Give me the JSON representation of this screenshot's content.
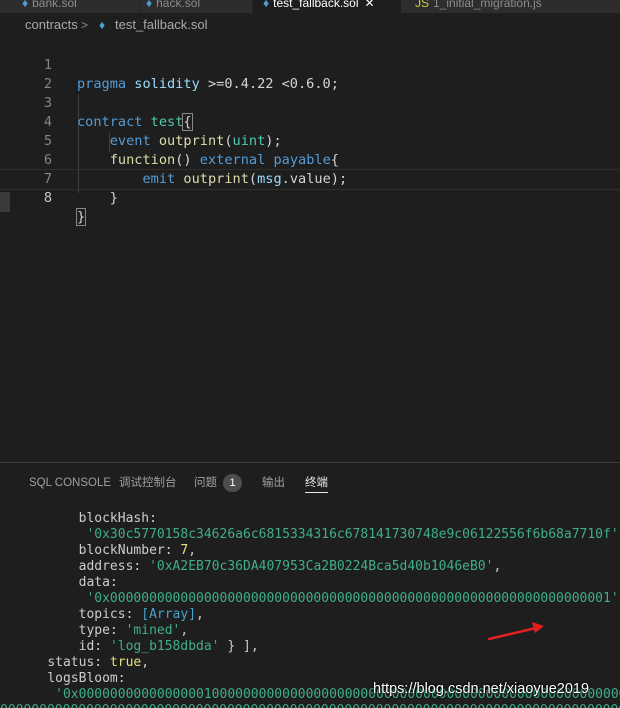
{
  "tabs": [
    {
      "label": "bank.sol",
      "icon": "solidity-file-icon",
      "active": false
    },
    {
      "label": "hack.sol",
      "icon": "solidity-file-icon",
      "active": false
    },
    {
      "label": "test_fallback.sol",
      "icon": "solidity-file-icon",
      "active": true
    },
    {
      "label": "1_initial_migration.js",
      "icon": "javascript-file-icon",
      "active": false
    }
  ],
  "breadcrumb": {
    "folder": "contracts",
    "separator": ">",
    "file_icon": "solidity-file-icon",
    "file": "test_fallback.sol"
  },
  "editor": {
    "line_numbers": [
      "1",
      "2",
      "3",
      "4",
      "5",
      "6",
      "7",
      "8"
    ],
    "code": {
      "l1": {
        "kw": "pragma",
        "name": "solidity",
        "rest": " >=0.4.22 <0.6.0;"
      },
      "l3": {
        "kw": "contract",
        "name": "test",
        "brace": "{"
      },
      "l4": {
        "indent": "    ",
        "kw": "event",
        "fn": "outprint",
        "open": "(",
        "type": "uint",
        "close": ");"
      },
      "l5": {
        "indent": "    ",
        "kw": "function",
        "open": "() ",
        "mod1": "external",
        "space": " ",
        "mod2": "payable",
        "brace": "{"
      },
      "l6": {
        "indent": "        ",
        "kw": "emit",
        "fn": "outprint",
        "open": "(",
        "obj": "msg",
        "rest": ".value);"
      },
      "l7": {
        "indent": "    ",
        "text": "}"
      },
      "l8": {
        "text": "}"
      }
    }
  },
  "panel": {
    "tabs": {
      "sql_console": "SQL CONSOLE",
      "debug_console": "调试控制台",
      "problems": "问题",
      "problems_count": "1",
      "output": "输出",
      "terminal": "终端"
    },
    "terminal": {
      "l01": {
        "indent": "        ",
        "key": "blockHash:"
      },
      "l02": {
        "indent": "         ",
        "str": "'0x30c5770158c34626a6c6815334316c678141730748e9c06122556f6b68a7710f'",
        "tail": ","
      },
      "l03": {
        "indent": "        ",
        "key": "blockNumber: ",
        "num": "7",
        "tail": ","
      },
      "l04": {
        "indent": "        ",
        "key": "address: ",
        "str": "'0xA2EB70c36DA407953Ca2B0224Bca5d40b1046eB0'",
        "tail": ","
      },
      "l05": {
        "indent": "        ",
        "key": "data:"
      },
      "l06": {
        "indent": "         ",
        "str": "'0x0000000000000000000000000000000000000000000000000000000000000001'",
        "tail": ","
      },
      "l07": {
        "indent": "        ",
        "key": "topics: ",
        "ref": "[Array]",
        "tail": ","
      },
      "l08": {
        "indent": "        ",
        "key": "type: ",
        "str": "'mined'",
        "tail": ","
      },
      "l09": {
        "indent": "        ",
        "key": "id: ",
        "str": "'log_b158dbda'",
        "tail": " } ],"
      },
      "l10": {
        "indent": "    ",
        "key": "status: ",
        "num": "true",
        "tail": ","
      },
      "l11": {
        "indent": "    ",
        "key": "logsBloom:"
      },
      "l12": {
        "indent": "     ",
        "str": "'0x0000000000000000100000000000000000000000000000000000000000000000000000000"
      },
      "l13": {
        "str": "00000000000000000000000000000000000000000000000000000000000000000000000000000000000000"
      }
    }
  },
  "watermark": "https://blog.csdn.net/xiaoyue2019",
  "colors": {
    "background": "#1e1e1e",
    "keyword": "#569cd6",
    "function": "#dcdcaa",
    "type": "#4ec9b0",
    "variable": "#9cdcfe",
    "terminal_string": "#3fae8a",
    "terminal_number": "#e5e07a",
    "terminal_ref": "#45a3c9",
    "arrow": "#e02020"
  }
}
